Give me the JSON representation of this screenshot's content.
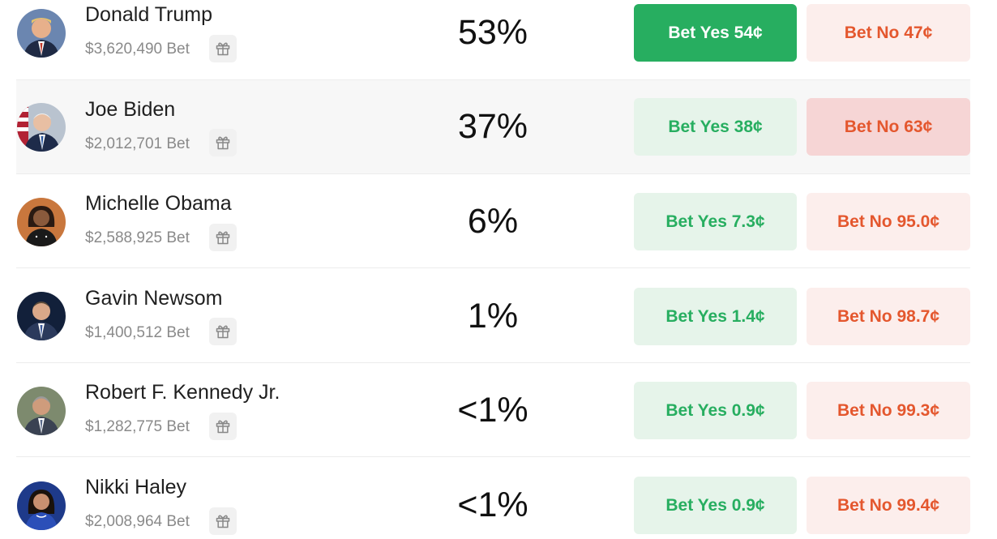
{
  "gift_icon": "gift-icon",
  "colors": {
    "yes_green": "#27ae60",
    "yes_bg": "#e6f4ea",
    "no_orange": "#e4572e",
    "no_bg": "#fceeec",
    "row_highlight": "#f7f7f7"
  },
  "rows": [
    {
      "name": "Donald Trump",
      "volume": "$3,620,490 Bet",
      "chance": "53%",
      "yes_label": "Bet Yes 54¢",
      "no_label": "Bet No 47¢"
    },
    {
      "name": "Joe Biden",
      "volume": "$2,012,701 Bet",
      "chance": "37%",
      "yes_label": "Bet Yes 38¢",
      "no_label": "Bet No 63¢"
    },
    {
      "name": "Michelle Obama",
      "volume": "$2,588,925 Bet",
      "chance": "6%",
      "yes_label": "Bet Yes 7.3¢",
      "no_label": "Bet No 95.0¢"
    },
    {
      "name": "Gavin Newsom",
      "volume": "$1,400,512 Bet",
      "chance": "1%",
      "yes_label": "Bet Yes 1.4¢",
      "no_label": "Bet No 98.7¢"
    },
    {
      "name": "Robert F. Kennedy Jr.",
      "volume": "$1,282,775 Bet",
      "chance": "<1%",
      "yes_label": "Bet Yes 0.9¢",
      "no_label": "Bet No 99.3¢"
    },
    {
      "name": "Nikki Haley",
      "volume": "$2,008,964 Bet",
      "chance": "<1%",
      "yes_label": "Bet Yes 0.9¢",
      "no_label": "Bet No 99.4¢"
    }
  ]
}
